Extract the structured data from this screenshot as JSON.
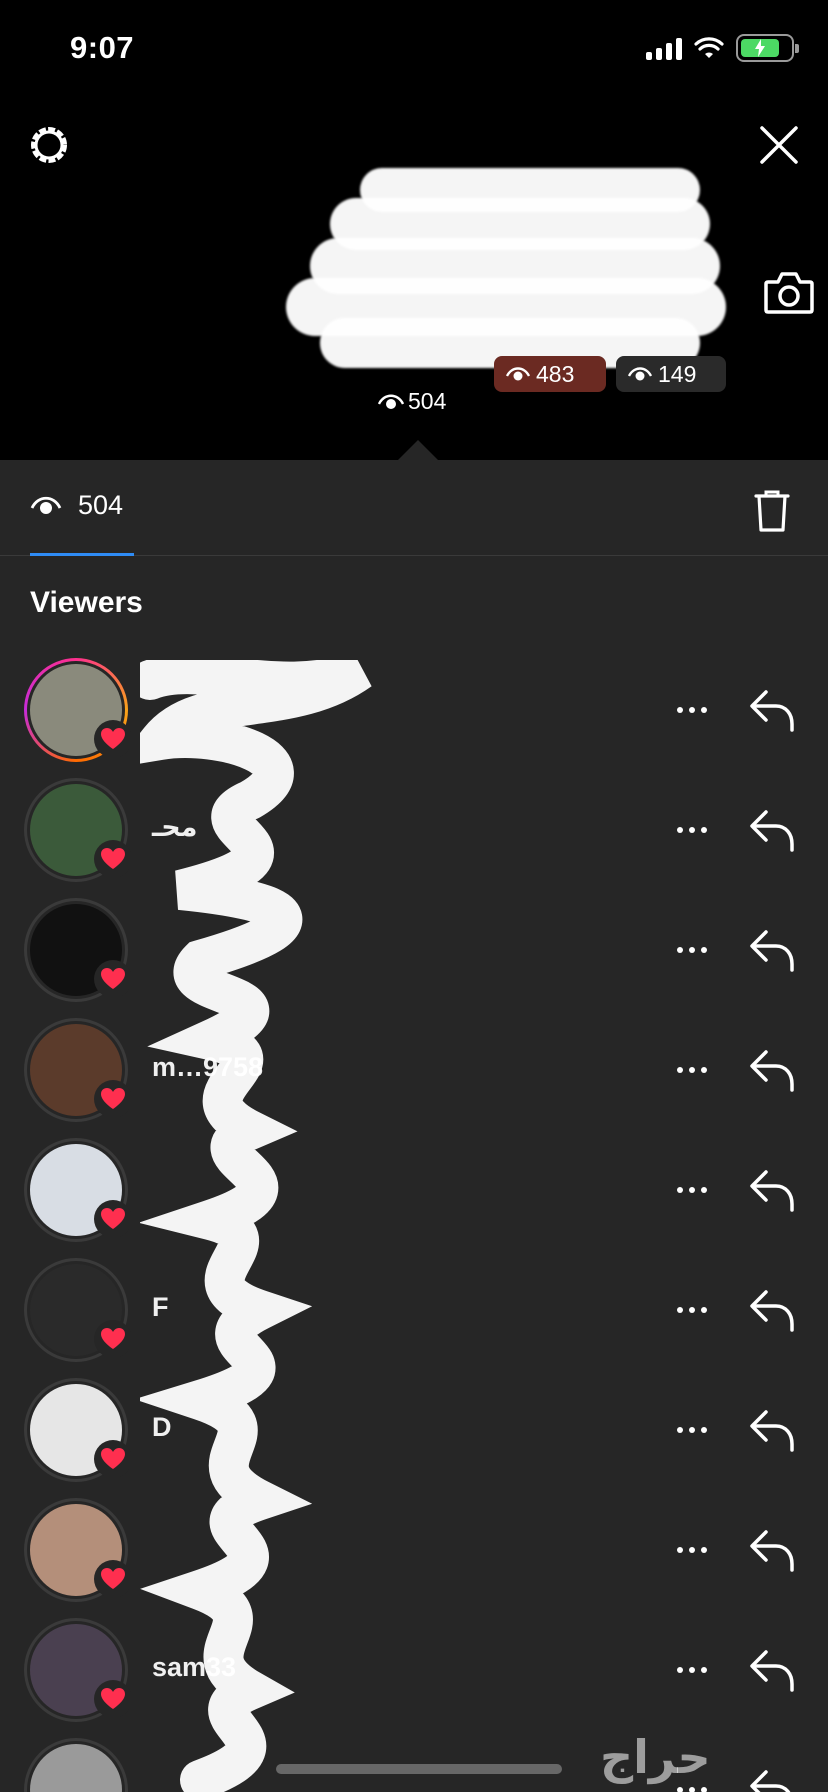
{
  "status_bar": {
    "time": "9:07"
  },
  "story": {
    "thumb_badges": [
      {
        "label": "483"
      },
      {
        "label": "149"
      }
    ],
    "current_views": "504"
  },
  "sheet": {
    "views_tab": {
      "count": "504"
    },
    "section_title": "Viewers"
  },
  "viewers": [
    {
      "name": "",
      "avatar_color": "#8a8a7c",
      "story_ring": true
    },
    {
      "name": "محـ",
      "avatar_color": "#3b5a3a",
      "story_ring": false
    },
    {
      "name": "",
      "avatar_color": "#111111",
      "story_ring": false
    },
    {
      "name": "m…9758",
      "avatar_color": "#5b3b2b",
      "story_ring": false
    },
    {
      "name": "",
      "avatar_color": "#d8dde4",
      "story_ring": false
    },
    {
      "name": "F",
      "avatar_color": "#2a2a2a",
      "story_ring": false
    },
    {
      "name": "D",
      "avatar_color": "#e6e6e6",
      "story_ring": false
    },
    {
      "name": "",
      "avatar_color": "#b48f7a",
      "story_ring": false
    },
    {
      "name": "sam33",
      "avatar_color": "#4a4050",
      "story_ring": false
    },
    {
      "name": "",
      "avatar_color": "#9a9a9a",
      "story_ring": false
    }
  ],
  "watermark": "حراج",
  "colors": {
    "accent": "#2f8cf5",
    "heart": "#ff2f4f",
    "sheet_bg": "#262626"
  }
}
